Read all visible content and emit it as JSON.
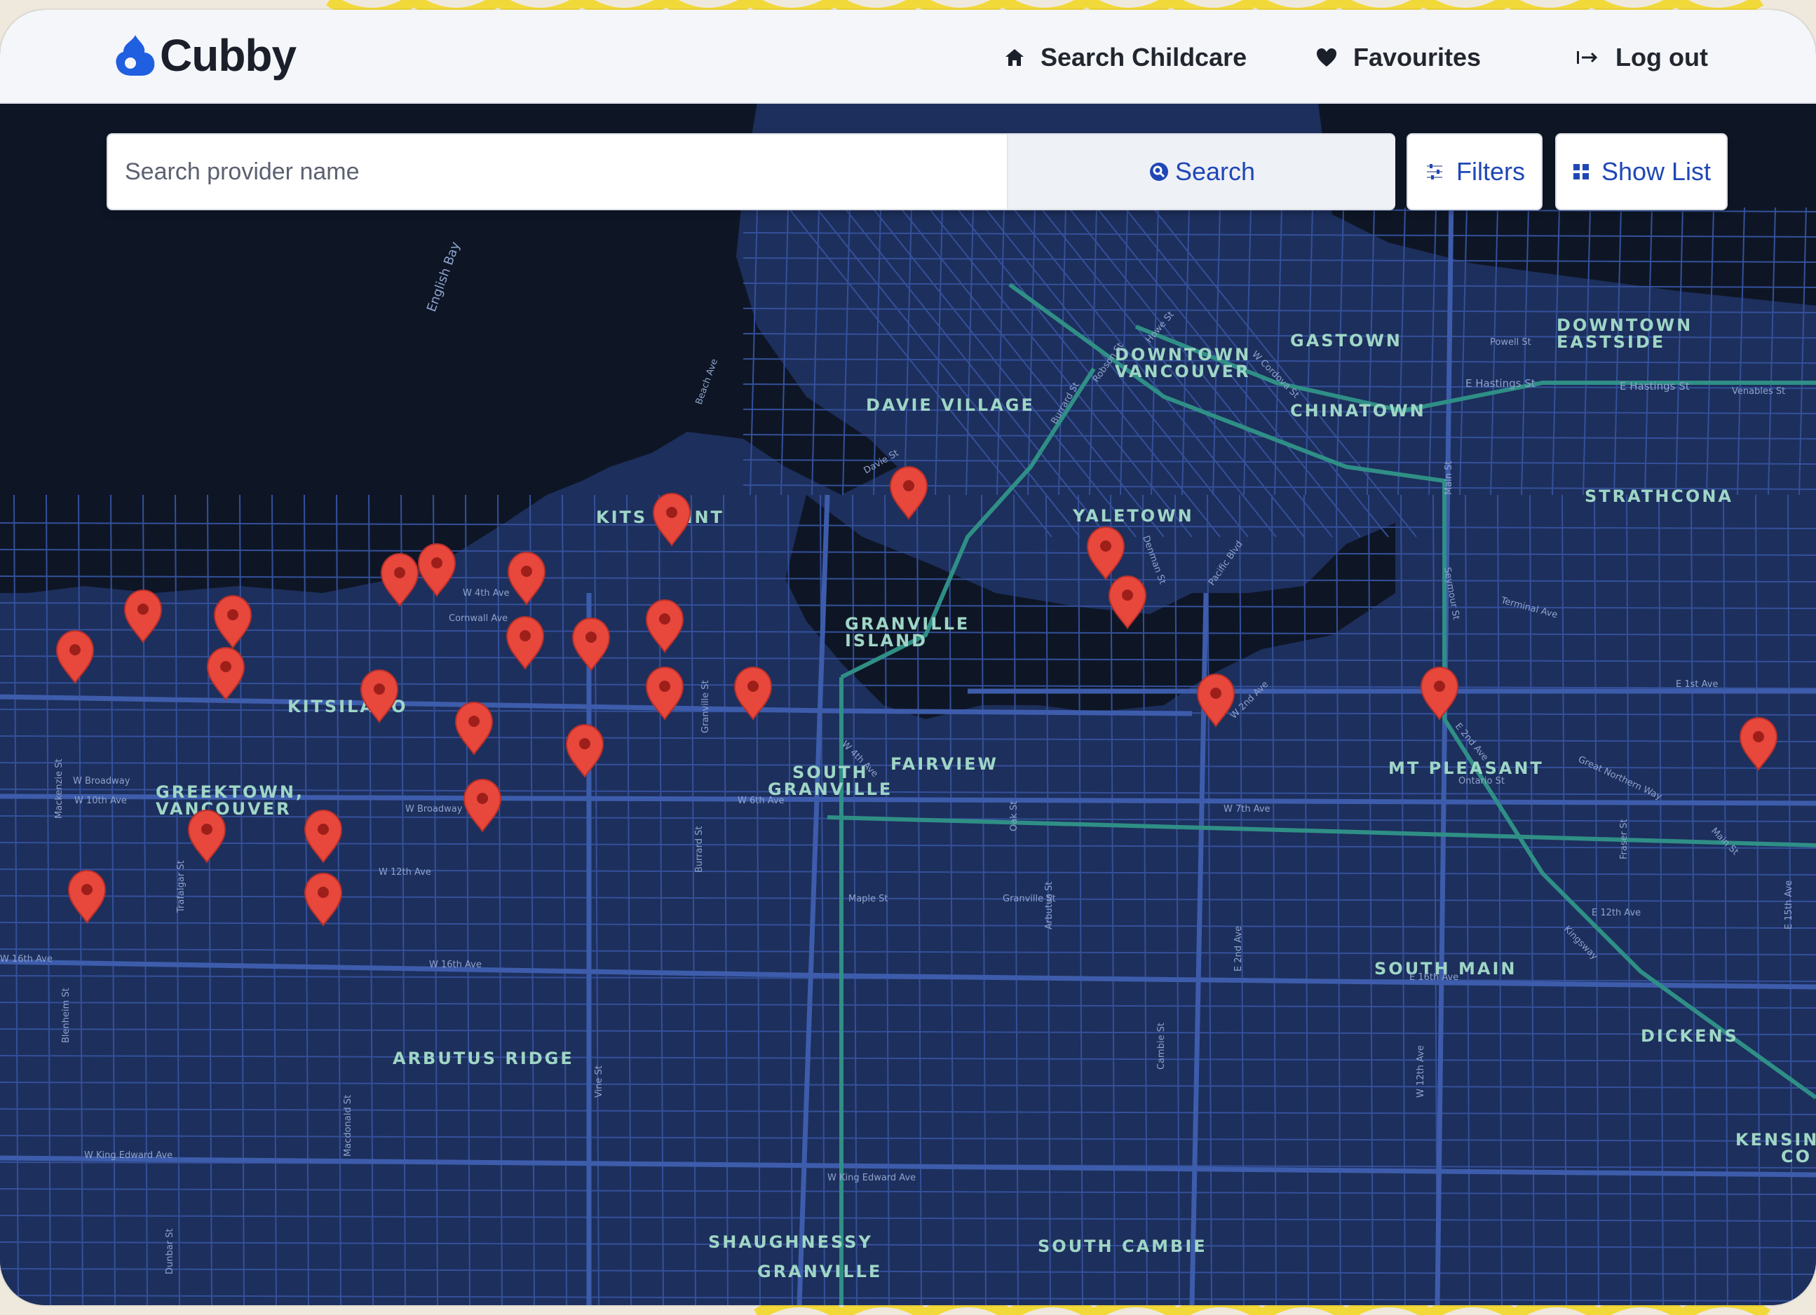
{
  "brand": {
    "name": "Cubby",
    "accent": "#1f5fe0"
  },
  "nav": {
    "search_childcare": "Search Childcare",
    "favourites": "Favourites",
    "logout": "Log out"
  },
  "search": {
    "placeholder": "Search provider name",
    "button": "Search",
    "filters": "Filters",
    "show_list": "Show List"
  },
  "icons": {
    "logo": "cubby-logo-icon",
    "home": "home-icon",
    "heart": "heart-icon",
    "logout": "logout-icon",
    "search": "search-icon",
    "filters": "sliders-icon",
    "grid": "grid-icon",
    "pin": "map-pin-icon"
  },
  "map": {
    "water_color": "#0e1626",
    "land_color": "#1d2f5c",
    "road_color": "#34509a",
    "transit_color": "#2f8f86",
    "pin_color": "#e8473c",
    "pin_count": 27,
    "neighborhoods": [
      "KITS POINT",
      "KITSILANO",
      "DAVIE VILLAGE",
      "DOWNTOWN",
      "VANCOUVER",
      "GASTOWN",
      "CHINATOWN",
      "DOWNTOWN",
      "EASTSIDE",
      "STRATHCONA",
      "YALETOWN",
      "GRANVILLE",
      "ISLAND",
      "FAIRVIEW",
      "SOUTH",
      "GRANVILLE",
      "MT PLEASANT",
      "GREEKTOWN,",
      "VANCOUVER",
      "SOUTH MAIN",
      "DICKENS",
      "ARBUTUS RIDGE",
      "SHAUGHNESSY",
      "SOUTH CAMBIE",
      "GRANVILLE",
      "KENSING",
      "CO"
    ],
    "streets": [
      "English Bay",
      "E Hastings St",
      "E Hastings St",
      "W 4th Ave",
      "W Broadway",
      "W Broadway",
      "W 10th Ave",
      "W 12th Ave",
      "W 16th Ave",
      "W 16th Ave",
      "W King Edward Ave",
      "W King Edward Ave",
      "E 12th Ave",
      "E 16th Ave",
      "Great Northern Way",
      "E 1st Ave",
      "Terminal Ave",
      "Powell St",
      "Venables St",
      "Main St",
      "Cambie St",
      "Fraser St",
      "Burrard St",
      "Granville St",
      "Arbutus St",
      "Oak St",
      "Kingsway",
      "Pacific Blvd",
      "W 2nd Ave",
      "W 4th Ave",
      "W 7th Ave",
      "E 2nd Ave",
      "Cornwall Ave",
      "Howe St",
      "Robson St",
      "Davie St",
      "Denman St",
      "Beach Ave",
      "Seymour St",
      "W Cordova St",
      "W 6th Ave",
      "Burrard St",
      "Vine St",
      "Macdonald St",
      "Mackenzie St",
      "Trafalgar St",
      "Blenheim St",
      "Dunbar St",
      "Maple St",
      "Granville St",
      "W 12th Ave",
      "Main St",
      "E 2nd Ave",
      "E 15th Ave",
      "Ontario St"
    ]
  }
}
